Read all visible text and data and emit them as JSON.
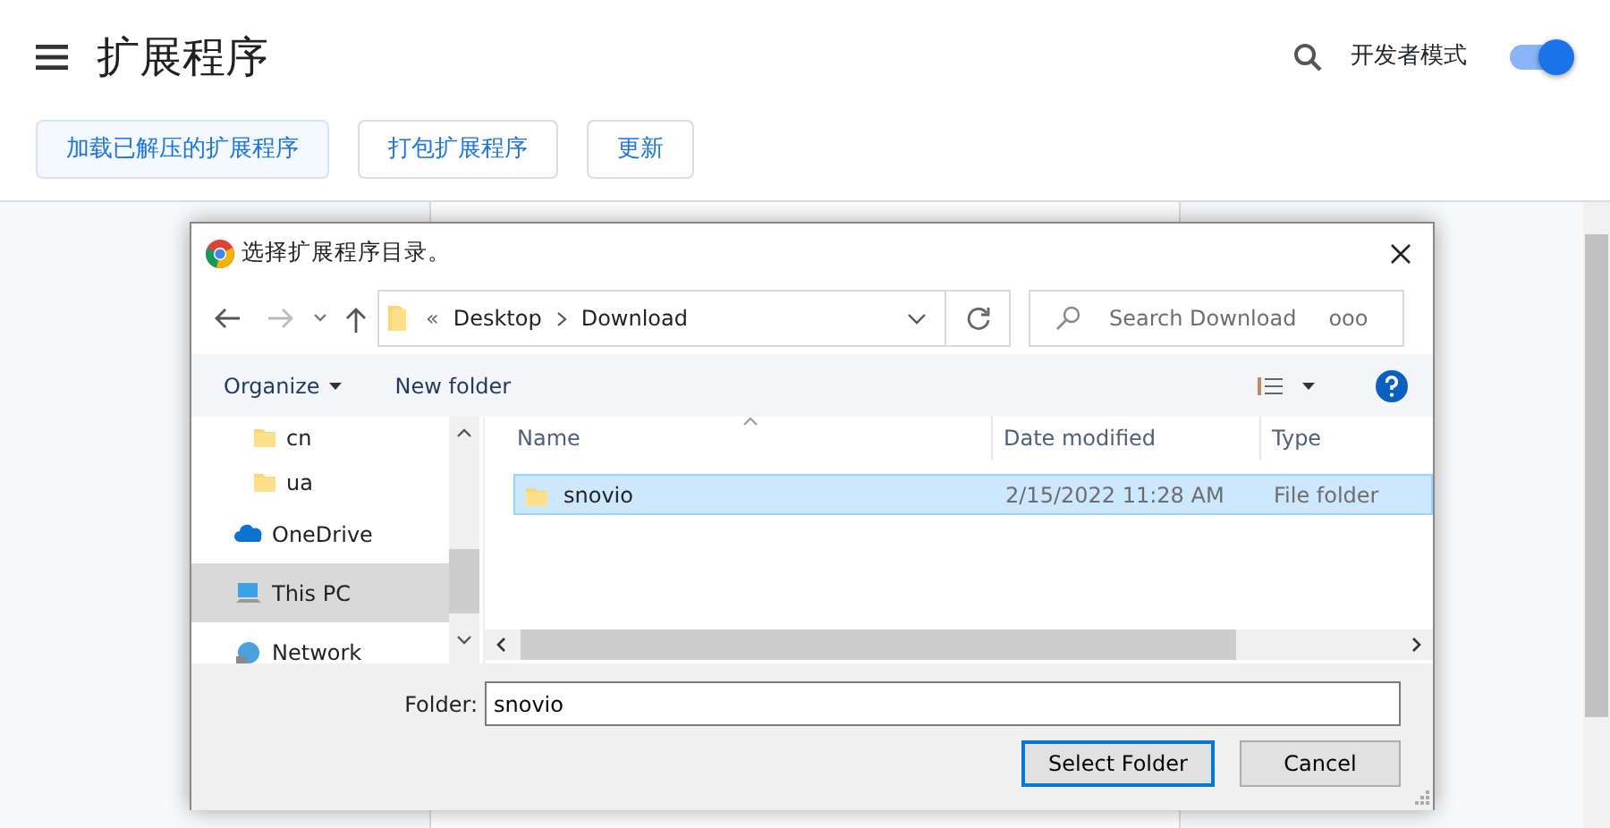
{
  "header": {
    "title": "扩展程序",
    "dev_mode_label": "开发者模式",
    "dev_mode_on": true
  },
  "actions": [
    {
      "label": "加载已解压的扩展程序",
      "highlighted": true
    },
    {
      "label": "打包扩展程序",
      "highlighted": false
    },
    {
      "label": "更新",
      "highlighted": false
    }
  ],
  "dialog": {
    "title": "选择扩展程序目录。",
    "address": {
      "overflow": "«",
      "crumbs": [
        "Desktop",
        "Download"
      ]
    },
    "search": {
      "placeholder": "Search Download",
      "suffix": "ooo"
    },
    "toolbar": {
      "organize": "Organize",
      "new_folder": "New folder"
    },
    "nav_items": [
      {
        "label": "cn",
        "kind": "folder",
        "selected": false
      },
      {
        "label": "ua",
        "kind": "folder",
        "selected": false
      },
      {
        "label": "OneDrive",
        "kind": "cloud",
        "selected": false
      },
      {
        "label": "This PC",
        "kind": "pc",
        "selected": true
      },
      {
        "label": "Network",
        "kind": "network",
        "selected": false
      }
    ],
    "columns": [
      "Name",
      "Date modified",
      "Type"
    ],
    "rows": [
      {
        "name": "snovio",
        "date": "2/15/2022 11:28 AM",
        "type": "File folder",
        "selected": true
      }
    ],
    "folder": {
      "label": "Folder:",
      "value": "snovio"
    },
    "buttons": [
      {
        "label": "Select Folder",
        "default": true
      },
      {
        "label": "Cancel",
        "default": false
      }
    ]
  }
}
